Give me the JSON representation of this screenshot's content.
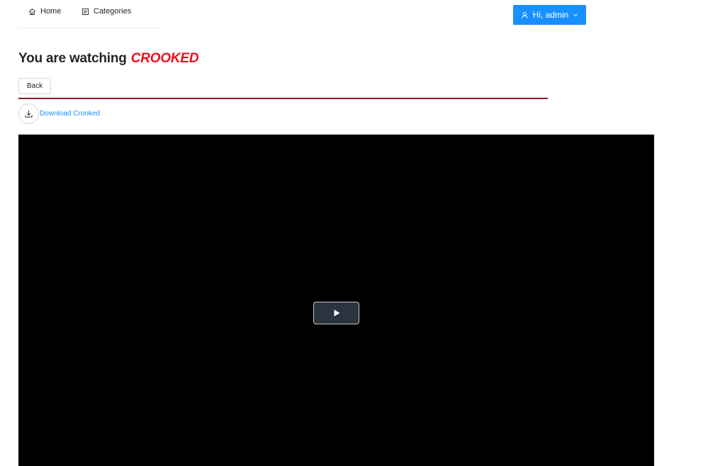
{
  "nav": {
    "items": [
      {
        "label": "Home",
        "icon": "home-icon"
      },
      {
        "label": "Categories",
        "icon": "categories-icon"
      }
    ]
  },
  "user_menu": {
    "label": "Hi, admin",
    "icon": "user-icon",
    "accent": "#1890ff"
  },
  "page": {
    "heading_prefix": "You are watching",
    "movie_title": "CROOKED",
    "movie_title_color": "#e8101b",
    "back_label": "Back",
    "download_label": "Download Crooked",
    "divider_color": "#8f1a2c"
  },
  "player": {
    "play_icon": "play-icon",
    "background": "#000000"
  }
}
